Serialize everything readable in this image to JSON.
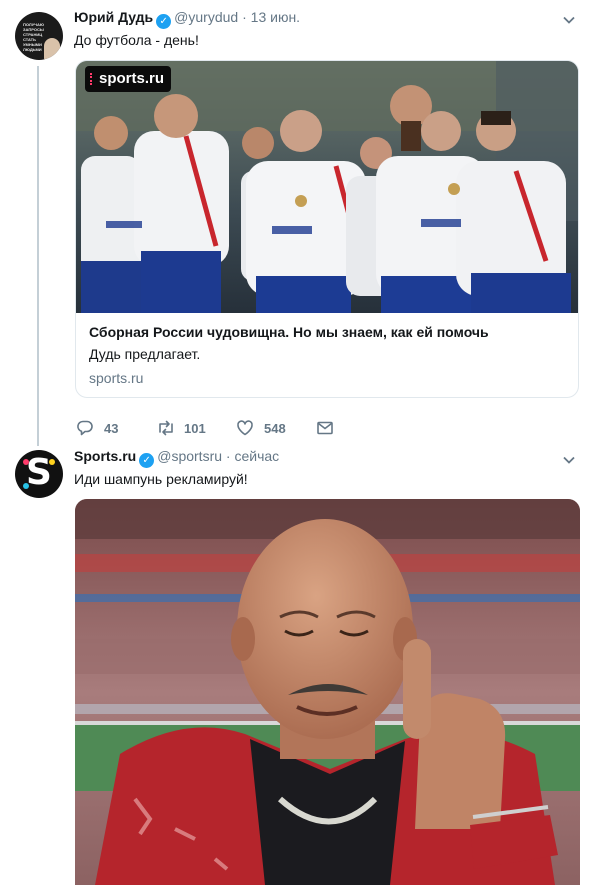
{
  "tweet1": {
    "avatar_text": "ПОЛУЧАЮ ЗАПРОСЫ СТРАНИЦ СТАТЬ УМНЫМИ ЛЮДЬМИ",
    "name": "Юрий Дудь",
    "handle": "@yurydud",
    "separator": "·",
    "time": "13 июн.",
    "text": "До футбола - день!",
    "card": {
      "logo": "sports.ru",
      "title": "Сборная России чудовищна. Но мы знаем, как ей помочь",
      "description": "Дудь предлагает.",
      "domain": "sports.ru"
    },
    "actions": {
      "replies": "43",
      "retweets": "101",
      "likes": "548"
    }
  },
  "tweet2": {
    "avatar_letter": "S",
    "name": "Sports.ru",
    "handle": "@sportsru",
    "separator": "·",
    "time": "сейчас",
    "text": "Иди шампунь рекламируй!"
  },
  "colors": {
    "verified": "#1da1f2",
    "secondary_text": "#657786",
    "primary_text": "#14171a",
    "thread_line": "#c4cfd6",
    "card_border": "#e1e8ed"
  },
  "icons": [
    "verified-badge-icon",
    "chevron-down-icon",
    "reply-icon",
    "retweet-icon",
    "like-icon",
    "message-icon"
  ]
}
